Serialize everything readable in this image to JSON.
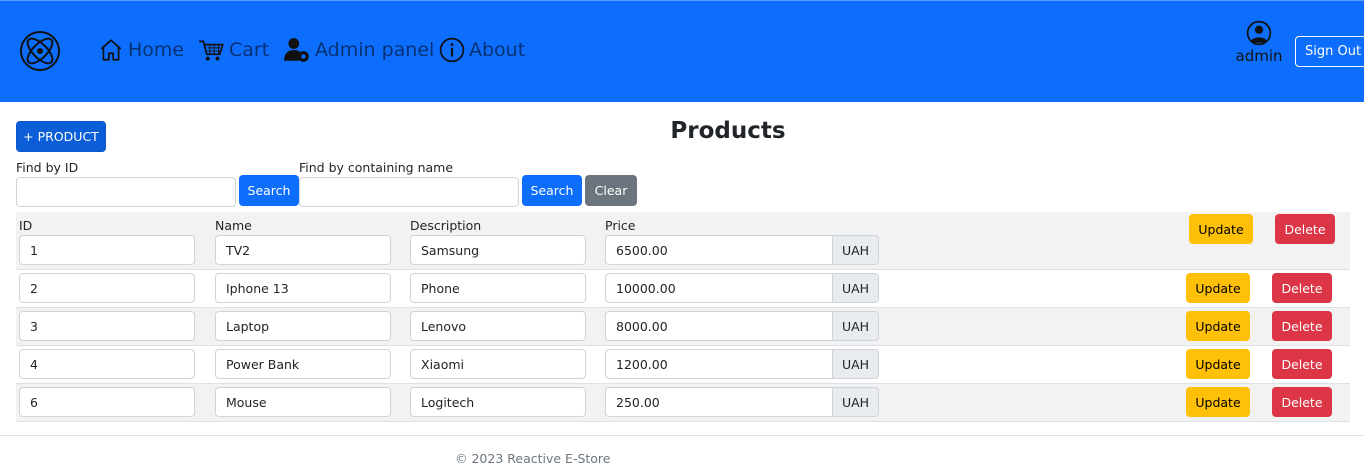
{
  "nav": {
    "logo_icon": "atom-logo-icon",
    "items": [
      {
        "label": "Home",
        "icon": "house-icon"
      },
      {
        "label": "Cart",
        "icon": "cart-icon"
      },
      {
        "label": "Admin panel",
        "icon": "user-gear-icon"
      },
      {
        "label": "About",
        "icon": "info-circle-icon"
      }
    ],
    "user": {
      "name": "admin",
      "icon": "user-circle-icon"
    },
    "signout_label": "Sign Out",
    "bg_color": "#0d6efd"
  },
  "toolbar": {
    "add_label": "+ PRODUCT",
    "title": "Products",
    "find_id_label": "Find by ID",
    "find_id_value": "",
    "find_name_label": "Find by containing name",
    "find_name_value": "",
    "search_label": "Search",
    "clear_label": "Clear"
  },
  "table": {
    "headers": [
      "ID",
      "Name",
      "Description",
      "Price"
    ],
    "currency": "UAH",
    "update_label": "Update",
    "delete_label": "Delete",
    "rows": [
      {
        "id": "1",
        "name": "TV2",
        "description": "Samsung",
        "price": "6500.00"
      },
      {
        "id": "2",
        "name": "Iphone 13",
        "description": "Phone",
        "price": "10000.00"
      },
      {
        "id": "3",
        "name": "Laptop",
        "description": "Lenovo",
        "price": "8000.00"
      },
      {
        "id": "4",
        "name": "Power Bank",
        "description": "Xiaomi",
        "price": "1200.00"
      },
      {
        "id": "6",
        "name": "Mouse",
        "description": "Logitech",
        "price": "250.00"
      }
    ]
  },
  "footer": {
    "text": "© 2023 Reactive E-Store"
  },
  "colors": {
    "primary": "#0d6efd",
    "warning": "#ffc107",
    "danger": "#dc3545",
    "secondary": "#6c757d"
  }
}
